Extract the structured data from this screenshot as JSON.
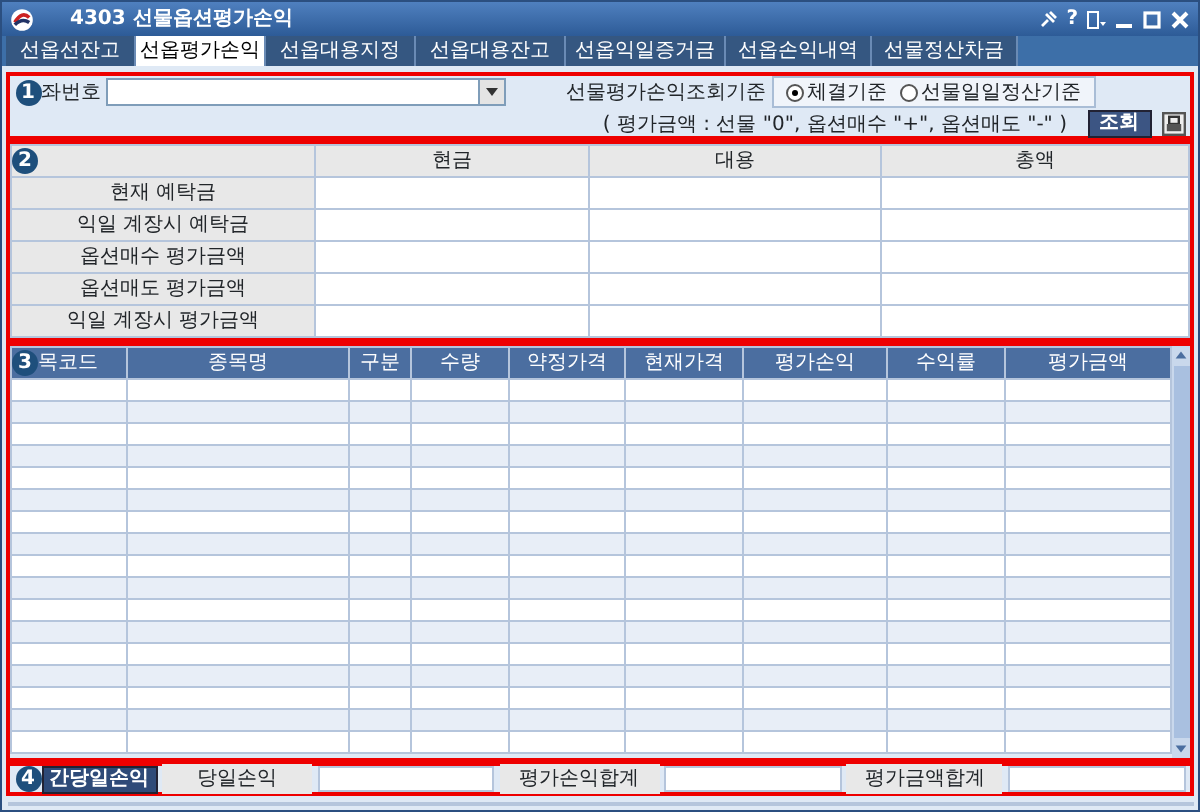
{
  "window": {
    "title": "4303 선물옵션평가손익",
    "help": "?"
  },
  "tabs": [
    {
      "label": "선옵선잔고",
      "selected": false
    },
    {
      "label": "선옵평가손익",
      "selected": true
    },
    {
      "label": "선옵대용지정",
      "selected": false
    },
    {
      "label": "선옵대용잔고",
      "selected": false
    },
    {
      "label": "선옵익일증거금",
      "selected": false
    },
    {
      "label": "선옵손익내역",
      "selected": false
    },
    {
      "label": "선물정산차금",
      "selected": false
    }
  ],
  "query": {
    "badge": "1",
    "account_label": "좌번호",
    "criteria_label": "선물평가손익조회기준",
    "radios": [
      {
        "label": "체결기준",
        "selected": true
      },
      {
        "label": "선물일일정산기준",
        "selected": false
      }
    ],
    "note": "( 평가금액 : 선물 \"0\", 옵션매수 \"+\", 옵션매도 \"-\" )",
    "search_button": "조회"
  },
  "deposit": {
    "badge": "2",
    "columns": [
      "현금",
      "대용",
      "총액"
    ],
    "rows": [
      "현재 예탁금",
      "익일 계장시 예탁금",
      "옵션매수 평가금액",
      "옵션매도 평가금액",
      "익일 계장시 평가금액"
    ]
  },
  "positions": {
    "badge": "3",
    "columns": [
      "목코드",
      "종목명",
      "구분",
      "수량",
      "약정가격",
      "현재가격",
      "평가손익",
      "수익률",
      "평가금액"
    ]
  },
  "summary": {
    "badge": "4",
    "button": "간당일손익",
    "labels": [
      "당일손익",
      "평가손익합계",
      "평가금액합계"
    ]
  }
}
